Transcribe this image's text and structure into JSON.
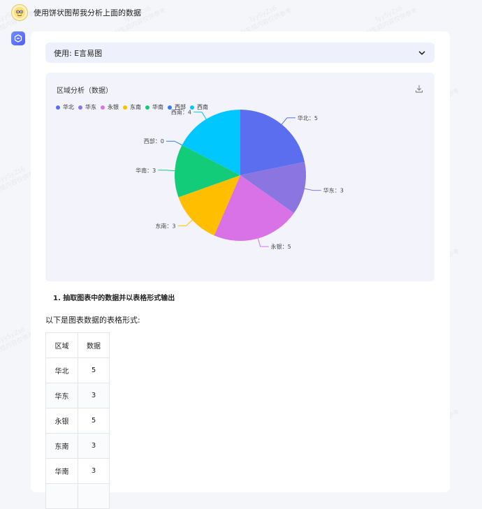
{
  "user": {
    "question": "使用饼状图帮我分析上面的数据"
  },
  "tool": {
    "label": "使用: E言易图"
  },
  "chart_data": {
    "type": "pie",
    "title": "区域分析（数据）",
    "categories": [
      "华北",
      "华东",
      "永银",
      "东南",
      "华南",
      "西部",
      "西南"
    ],
    "values": [
      5,
      3,
      5,
      3,
      3,
      0,
      4
    ],
    "slice_labels": [
      "华北：5",
      "华东：3",
      "永银：5",
      "东南：3",
      "华南：3",
      "西部：0",
      "西南：4"
    ],
    "colors": [
      "#5b6ef0",
      "#8b75e0",
      "#d872e6",
      "#ffbe00",
      "#12cc7a",
      "#2c7df0",
      "#00c8ff"
    ],
    "legend_position": "top-left"
  },
  "answer": {
    "heading": "1. 抽取图表中的数据并以表格形式输出",
    "intro": "以下是图表数据的表格形式:",
    "table": {
      "headers": [
        "区域",
        "数据"
      ],
      "rows": [
        [
          "华北",
          "5"
        ],
        [
          "华东",
          "3"
        ],
        [
          "永银",
          "5"
        ],
        [
          "东南",
          "3"
        ],
        [
          "华南",
          "3"
        ],
        [
          "",
          ""
        ]
      ]
    }
  },
  "watermark": {
    "line1": "TyySyZs6",
    "line2": "AI生成内容仅供参考"
  }
}
